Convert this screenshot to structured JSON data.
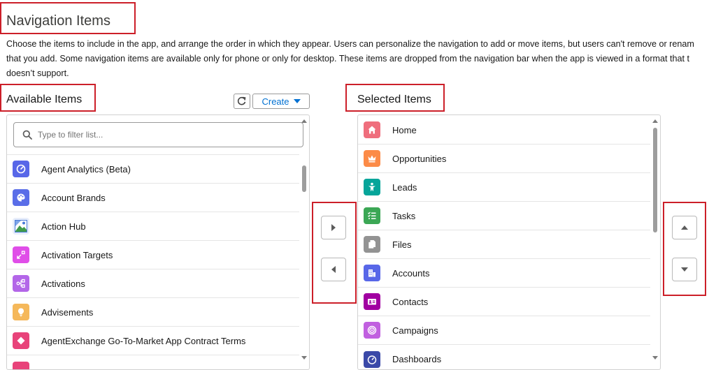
{
  "page": {
    "title": "Navigation Items",
    "description_lines": [
      "Choose the items to include in the app, and arrange the order in which they appear. Users can personalize the navigation to add or move items, but users can't remove or renam",
      "that you add. Some navigation items are available only for phone or only for desktop. These items are dropped from the navigation bar when the app is viewed in a format that t",
      "doesn’t support."
    ]
  },
  "available": {
    "title": "Available Items",
    "create_label": "Create",
    "refresh_icon": "refresh-icon",
    "search_placeholder": "Type to filter list...",
    "items": [
      {
        "label": "Agent Analytics (Beta)",
        "icon": "gauge-icon",
        "color": "#5867e8"
      },
      {
        "label": "Account Brands",
        "icon": "palette-icon",
        "color": "#5a6ee8"
      },
      {
        "label": "Action Hub",
        "icon": "image-icon",
        "color": "#4a7bd8"
      },
      {
        "label": "Activation Targets",
        "icon": "target-arrows-icon",
        "color": "#e04ee8"
      },
      {
        "label": "Activations",
        "icon": "nodes-icon",
        "color": "#b366e8"
      },
      {
        "label": "Advisements",
        "icon": "lightbulb-icon",
        "color": "#f5b85a"
      },
      {
        "label": "AgentExchange Go-To-Market App Contract Terms",
        "icon": "diamond-icon",
        "color": "#e8437a"
      }
    ]
  },
  "selected": {
    "title": "Selected Items",
    "items": [
      {
        "label": "Home",
        "icon": "home-icon",
        "color": "#ef6e7d"
      },
      {
        "label": "Opportunities",
        "icon": "crown-icon",
        "color": "#fc8b47"
      },
      {
        "label": "Leads",
        "icon": "person-star-icon",
        "color": "#06a59a"
      },
      {
        "label": "Tasks",
        "icon": "checklist-icon",
        "color": "#3ba755"
      },
      {
        "label": "Files",
        "icon": "files-icon",
        "color": "#939393"
      },
      {
        "label": "Accounts",
        "icon": "building-icon",
        "color": "#5867e8"
      },
      {
        "label": "Contacts",
        "icon": "contact-card-icon",
        "color": "#a100a1"
      },
      {
        "label": "Campaigns",
        "icon": "target-icon",
        "color": "#c160e0"
      },
      {
        "label": "Dashboards",
        "icon": "dashboard-icon",
        "color": "#3a49a8"
      }
    ]
  }
}
